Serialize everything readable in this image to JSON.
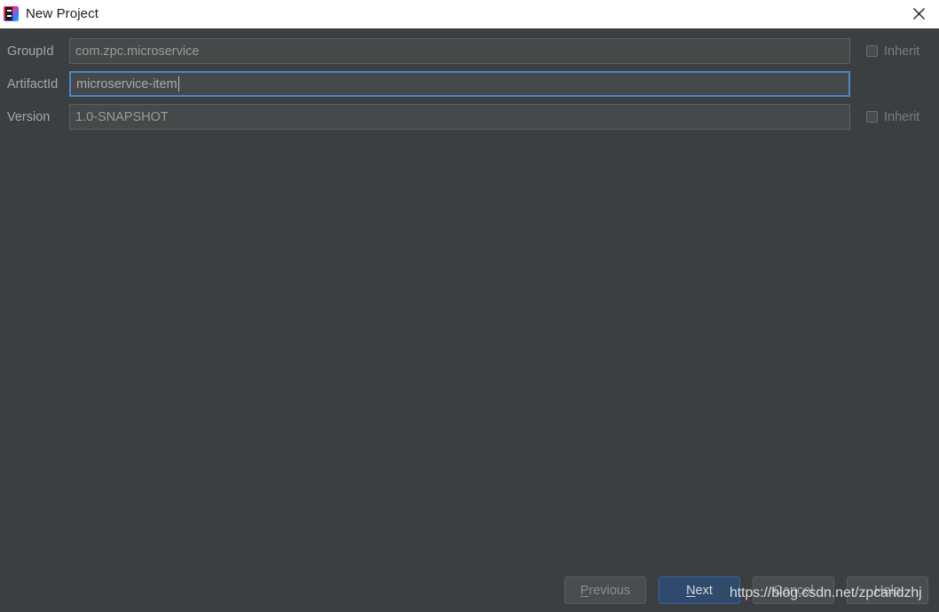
{
  "window": {
    "title": "New Project",
    "logo_icon": "intellij-idea-logo",
    "close_icon": "close-icon"
  },
  "form": {
    "rows": [
      {
        "label": "GroupId",
        "value": "com.zpc.microservice",
        "focused": false,
        "inherit": {
          "label": "Inherit",
          "checked": false,
          "visible": true
        }
      },
      {
        "label": "ArtifactId",
        "value": "microservice-item",
        "focused": true,
        "inherit": {
          "label": "",
          "checked": false,
          "visible": false
        }
      },
      {
        "label": "Version",
        "value": "1.0-SNAPSHOT",
        "focused": false,
        "inherit": {
          "label": "Inherit",
          "checked": false,
          "visible": true
        }
      }
    ]
  },
  "footer": {
    "buttons": [
      {
        "name": "previous",
        "label": "Previous",
        "mnemonic": "P",
        "style": "disabled"
      },
      {
        "name": "next",
        "label": "Next",
        "mnemonic": "N",
        "style": "default"
      },
      {
        "name": "cancel",
        "label": "Cancel",
        "mnemonic": "",
        "style": "normal"
      },
      {
        "name": "help",
        "label": "Help",
        "mnemonic": "",
        "style": "normal"
      }
    ]
  },
  "watermark": {
    "text": "https://blog.csdn.net/zpcandzhj"
  },
  "colors": {
    "dialog_background": "#3c3f41",
    "titlebar_background": "#ffffff",
    "field_background": "#45494a",
    "focus_border": "#4a88c7",
    "default_button": "#2f4a6d",
    "label_text": "#a6a6a6"
  }
}
